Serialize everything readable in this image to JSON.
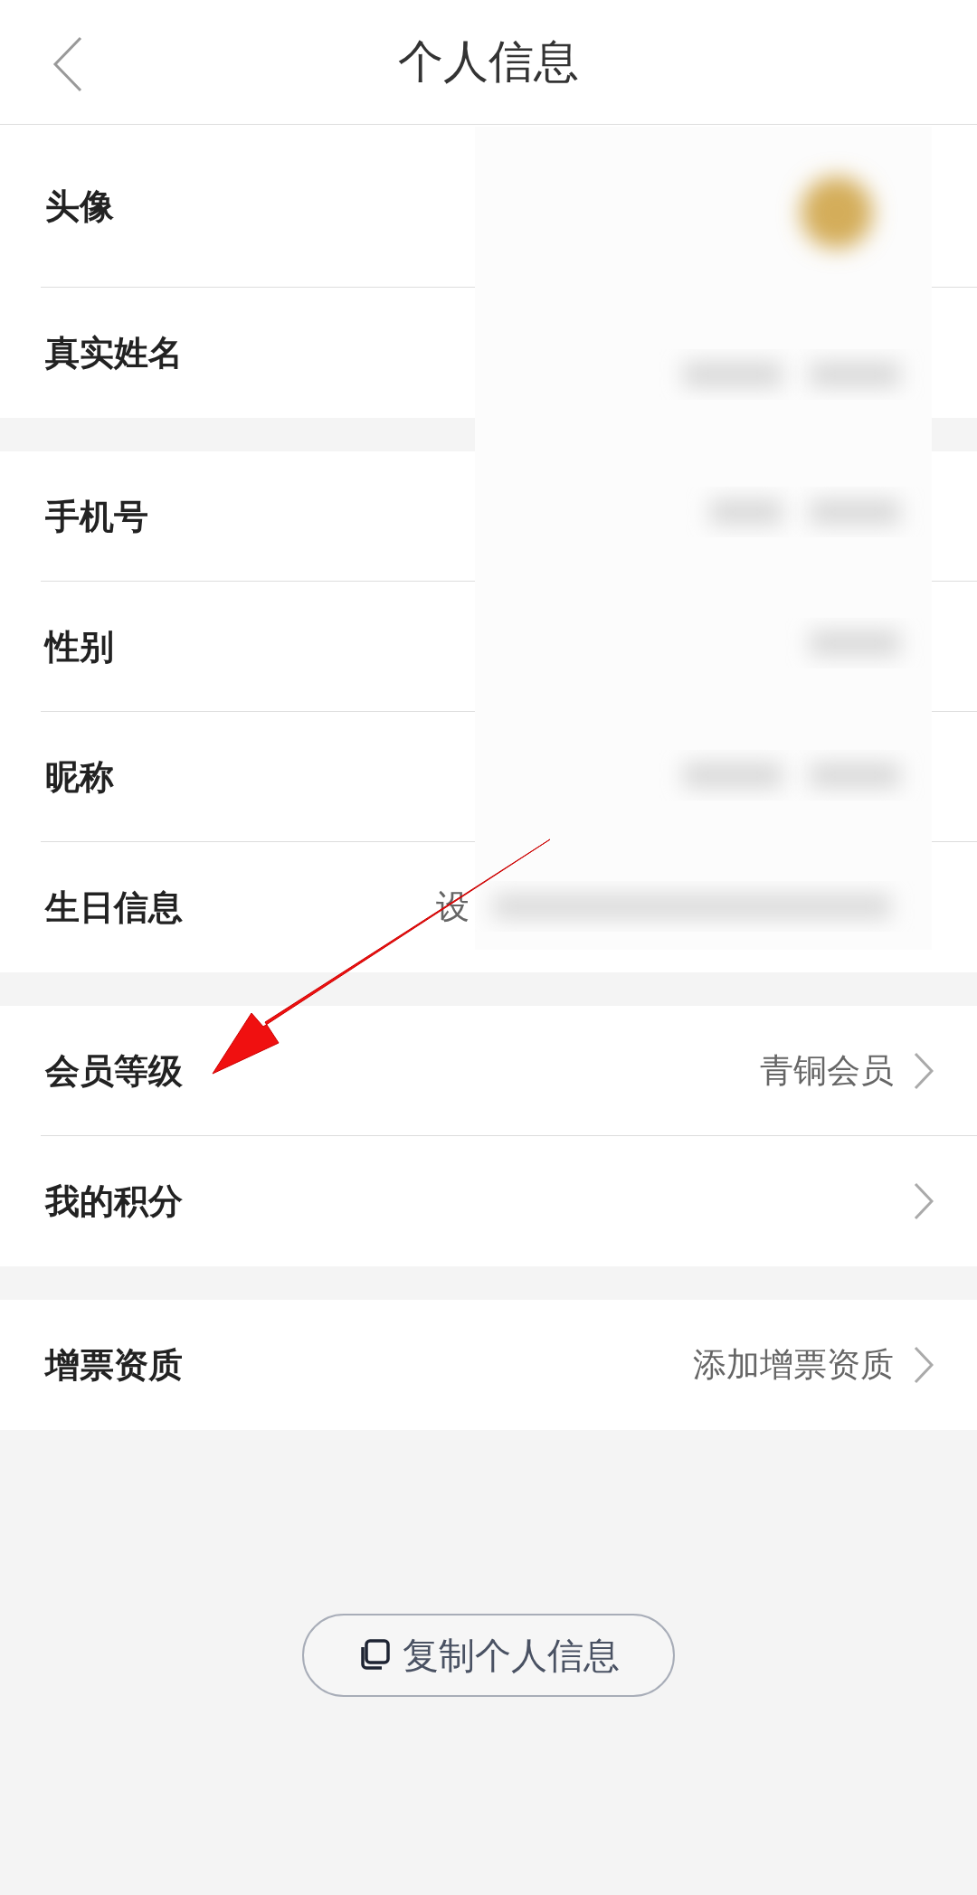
{
  "header": {
    "title": "个人信息"
  },
  "sections": [
    {
      "rows": [
        {
          "label": "头像",
          "kind": "avatar",
          "chevron": false
        },
        {
          "label": "真实姓名",
          "kind": "value",
          "chevron": false
        }
      ]
    },
    {
      "rows": [
        {
          "label": "手机号",
          "kind": "value",
          "chevron": false
        },
        {
          "label": "性别",
          "kind": "value",
          "chevron": false
        },
        {
          "label": "昵称",
          "kind": "value",
          "chevron": false
        },
        {
          "label": "生日信息",
          "kind": "masked",
          "value": "设",
          "chevron": false
        }
      ]
    },
    {
      "rows": [
        {
          "label": "会员等级",
          "kind": "value",
          "value": "青铜会员",
          "chevron": true
        },
        {
          "label": "我的积分",
          "kind": "value",
          "chevron": true
        }
      ]
    },
    {
      "rows": [
        {
          "label": "增票资质",
          "kind": "value",
          "value": "添加增票资质",
          "chevron": true
        }
      ]
    }
  ],
  "copy_button": {
    "label": "复制个人信息"
  }
}
